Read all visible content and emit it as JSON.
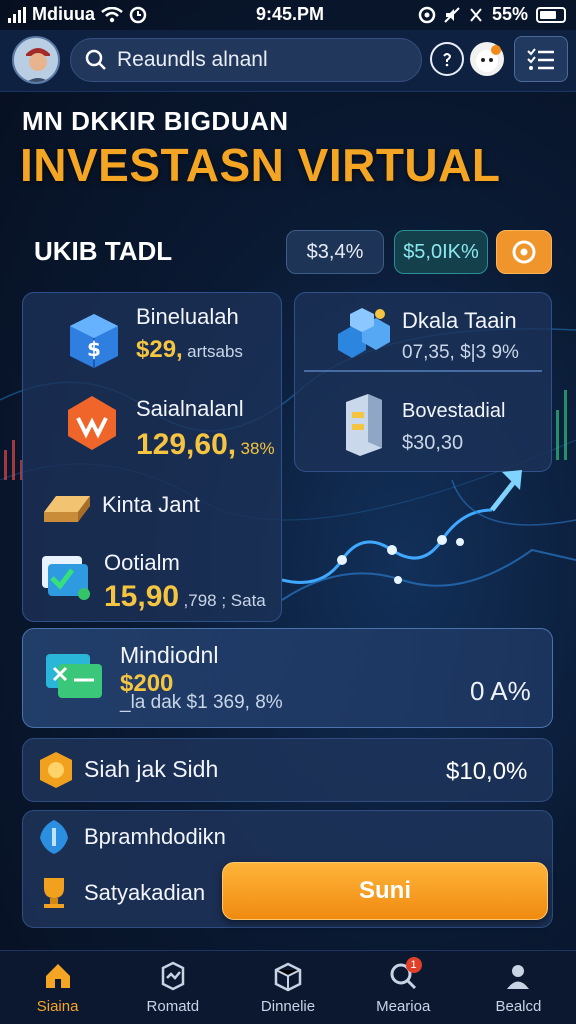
{
  "status_bar": {
    "carrier": "Mdiuua",
    "time": "9:45.PM",
    "battery": "55%"
  },
  "search": {
    "value": "Reaundls alnanl"
  },
  "hero": {
    "subtitle": "MN DKKIR BIGDUAN",
    "title": "INVESTASN VIRTUAL"
  },
  "summary": {
    "label": "UKIB TADL",
    "pill_1": "$3,4%",
    "pill_2": "$5,0IK%"
  },
  "left_panel": {
    "items": [
      {
        "title": "Binelualah",
        "value": "$29,",
        "note": "artsabs"
      },
      {
        "title": "Saialnalanl",
        "value": "129,60,",
        "note": "38%"
      },
      {
        "title": "Kinta Jant"
      },
      {
        "title": "Ootialm",
        "value": "15,90",
        "note": ",798 ; Sata"
      }
    ]
  },
  "right_panel": {
    "items": [
      {
        "title": "Dkala Taain",
        "sub": "07,35, $|3 9%"
      },
      {
        "title": "Bovestadial",
        "sub": "$30,30"
      }
    ]
  },
  "wide_card": {
    "title": "Mindiodnl",
    "value": "$200",
    "sub": "_la dak $1 369, 8%",
    "right": "0 A%"
  },
  "row_card": {
    "label": "Siah jak Sidh",
    "value": "$10,0%"
  },
  "bottom_card": {
    "line_1": "Bpramhdodikn",
    "line_2": "Satyakadian",
    "cta": "Suni"
  },
  "bottom_nav": [
    {
      "label": "Siaina",
      "active": true
    },
    {
      "label": "Romatd"
    },
    {
      "label": "Dinnelie"
    },
    {
      "label": "Mearioa",
      "badge": "1"
    },
    {
      "label": "Bealcd"
    }
  ],
  "colors": {
    "accent": "#f5a524",
    "background": "#0a1a33",
    "teal": "#8ce8f0"
  }
}
